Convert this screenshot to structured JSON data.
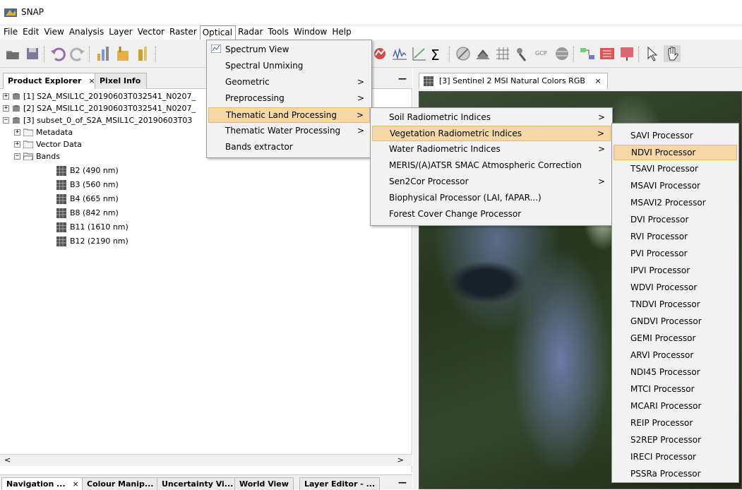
{
  "window": {
    "title": "SNAP"
  },
  "menubar": [
    "File",
    "Edit",
    "View",
    "Analysis",
    "Layer",
    "Vector",
    "Raster",
    "Optical",
    "Radar",
    "Tools",
    "Window",
    "Help"
  ],
  "left_panel": {
    "tabs": [
      "Product Explorer",
      "Pixel Info"
    ],
    "tree": [
      "[1] S2A_MSIL1C_20190603T032541_N0207_",
      "[2] S2A_MSIL1C_20190603T032541_N0207_",
      "[3] subset_0_of_S2A_MSIL1C_20190603T03",
      "Metadata",
      "Vector Data",
      "Bands",
      "B2 (490 nm)",
      "B3 (560 nm)",
      "B4 (665 nm)",
      "B8 (842 nm)",
      "B11 (1610 nm)",
      "B12 (2190 nm)"
    ],
    "bottom_tabs": [
      "Navigation ...",
      "Colour Manip...",
      "Uncertainty Vi...",
      "World View",
      "Layer Editor - ..."
    ]
  },
  "image_tab": {
    "label": "[3] Sentinel 2 MSI Natural Colors RGB"
  },
  "optical_menu": [
    {
      "label": "Spectrum View",
      "submenu": false
    },
    {
      "label": "Spectral Unmixing",
      "submenu": false
    },
    {
      "label": "Geometric",
      "submenu": true
    },
    {
      "label": "Preprocessing",
      "submenu": true
    },
    {
      "label": "Thematic Land Processing",
      "submenu": true
    },
    {
      "label": "Thematic Water Processing",
      "submenu": true
    },
    {
      "label": "Bands extractor",
      "submenu": false
    }
  ],
  "land_menu": [
    {
      "label": "Soil Radiometric Indices",
      "submenu": true
    },
    {
      "label": "Vegetation Radiometric Indices",
      "submenu": true
    },
    {
      "label": "Water Radiometric Indices",
      "submenu": true
    },
    {
      "label": "MERIS/(A)ATSR SMAC Atmospheric Correction",
      "submenu": false
    },
    {
      "label": "Sen2Cor Processor",
      "submenu": true
    },
    {
      "label": "Biophysical Processor (LAI, fAPAR...)",
      "submenu": false
    },
    {
      "label": "Forest Cover Change Processor",
      "submenu": false
    }
  ],
  "veg_menu": [
    "SAVI Processor",
    "NDVI Processor",
    "TSAVI Processor",
    "MSAVI Processor",
    "MSAVI2 Processor",
    "DVI Processor",
    "RVI Processor",
    "PVI Processor",
    "IPVI Processor",
    "WDVI Processor",
    "TNDVI Processor",
    "GNDVI Processor",
    "GEMI Processor",
    "ARVI Processor",
    "NDI45 Processor",
    "MTCI Processor",
    "MCARI Processor",
    "REIP Processor",
    "S2REP Processor",
    "IRECI Processor",
    "PSSRa Processor"
  ],
  "toolbar": {
    "sigma": "Σ",
    "gcp": "GCP"
  },
  "colors": {
    "highlight": "#f6d8a6",
    "highlight_border": "#e8b866"
  }
}
